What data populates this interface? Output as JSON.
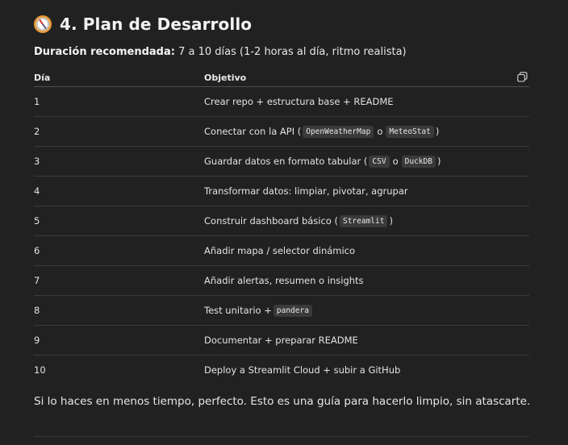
{
  "heading": {
    "icon": "compass-icon",
    "title": "4. Plan de Desarrollo"
  },
  "duration": {
    "label": "Duración recomendada:",
    "value": "7 a 10 días (1-2 horas al día, ritmo realista)"
  },
  "table": {
    "headers": {
      "day": "Día",
      "objective": "Objetivo"
    },
    "copy_icon": "copy-icon",
    "rows": [
      {
        "day": "1",
        "parts": [
          {
            "t": "text",
            "v": "Crear repo + estructura base + README"
          }
        ]
      },
      {
        "day": "2",
        "parts": [
          {
            "t": "text",
            "v": "Conectar con la API ("
          },
          {
            "t": "code",
            "v": "OpenWeatherMap"
          },
          {
            "t": "text",
            "v": "o"
          },
          {
            "t": "code",
            "v": "MeteoStat"
          },
          {
            "t": "text",
            "v": ")"
          }
        ]
      },
      {
        "day": "3",
        "parts": [
          {
            "t": "text",
            "v": "Guardar datos en formato tabular ("
          },
          {
            "t": "code",
            "v": "CSV"
          },
          {
            "t": "text",
            "v": "o"
          },
          {
            "t": "code",
            "v": "DuckDB"
          },
          {
            "t": "text",
            "v": ")"
          }
        ]
      },
      {
        "day": "4",
        "parts": [
          {
            "t": "text",
            "v": "Transformar datos: limpiar, pivotar, agrupar"
          }
        ]
      },
      {
        "day": "5",
        "parts": [
          {
            "t": "text",
            "v": "Construir dashboard básico ("
          },
          {
            "t": "code",
            "v": "Streamlit"
          },
          {
            "t": "text",
            "v": ")"
          }
        ]
      },
      {
        "day": "6",
        "parts": [
          {
            "t": "text",
            "v": "Añadir mapa / selector dinámico"
          }
        ]
      },
      {
        "day": "7",
        "parts": [
          {
            "t": "text",
            "v": "Añadir alertas, resumen o insights"
          }
        ]
      },
      {
        "day": "8",
        "parts": [
          {
            "t": "text",
            "v": "Test unitario +"
          },
          {
            "t": "code",
            "v": "pandera"
          }
        ]
      },
      {
        "day": "9",
        "parts": [
          {
            "t": "text",
            "v": "Documentar + preparar README"
          }
        ]
      },
      {
        "day": "10",
        "parts": [
          {
            "t": "text",
            "v": "Deploy a Streamlit Cloud + subir a GitHub"
          }
        ]
      }
    ]
  },
  "footer": {
    "text": "Si lo haces en menos tiempo, perfecto. Esto es una guía para hacerlo limpio, sin atascarte."
  }
}
